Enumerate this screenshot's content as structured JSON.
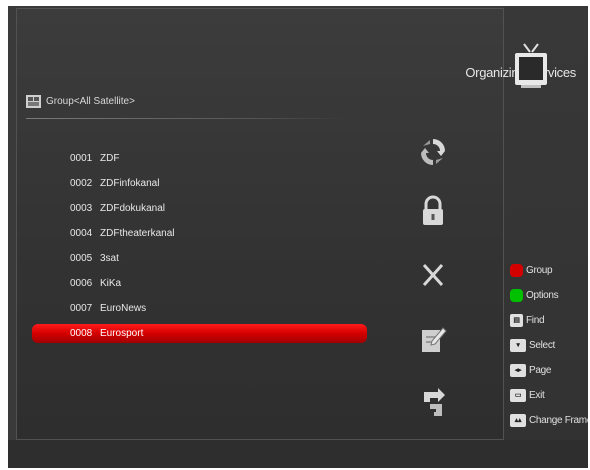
{
  "header": {
    "title": "Organizing Services"
  },
  "group": {
    "label": "Group<All Satellite>"
  },
  "channels": [
    {
      "num": "0001",
      "name": "ZDF"
    },
    {
      "num": "0002",
      "name": "ZDFinfokanal"
    },
    {
      "num": "0003",
      "name": "ZDFdokukanal"
    },
    {
      "num": "0004",
      "name": "ZDFtheaterkanal"
    },
    {
      "num": "0005",
      "name": "3sat"
    },
    {
      "num": "0006",
      "name": "KiKa"
    },
    {
      "num": "0007",
      "name": "EuroNews"
    },
    {
      "num": "0008",
      "name": "Eurosport"
    }
  ],
  "selected_index": 7,
  "legend": {
    "group": "Group",
    "options": "Options",
    "find": "Find",
    "select": "Select",
    "page": "Page",
    "exit": "Exit",
    "change_frame": "Change Frame"
  },
  "icons": [
    "move-icon",
    "lock-icon",
    "delete-icon",
    "rename-icon",
    "skip-icon"
  ],
  "colors": {
    "selection": "#d40000",
    "red_key": "#d40000",
    "green_key": "#00c000",
    "background": "#3a3a3a"
  }
}
